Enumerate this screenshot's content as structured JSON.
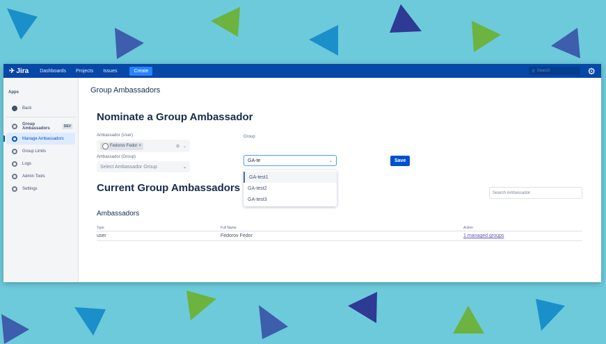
{
  "header": {
    "logo": "Jira",
    "nav": [
      "Dashboards",
      "Projects",
      "Issues"
    ],
    "create": "Create",
    "search_placeholder": "Search"
  },
  "sidebar": {
    "section": "Apps",
    "back": "Back",
    "app": "Group Ambassadors",
    "badge": "DEV",
    "items": [
      "Manage Ambassadors",
      "Group Limits",
      "Logs",
      "Admin Tools",
      "Settings"
    ]
  },
  "main": {
    "page_title": "Group Ambassadors",
    "nominate_title": "Nominate a Group Ambassador",
    "user_label": "Ambassador (User)",
    "user_value": "Fedorov Fedor",
    "group_ambassador_label": "Ambassador (Group)",
    "group_ambassador_placeholder": "Select Ambassador Group",
    "group_label": "Group",
    "group_value": "GA-te",
    "group_options": [
      "GA-test1",
      "GA-test2",
      "GA-test3"
    ],
    "save": "Save",
    "current_title": "Current Group Ambassadors",
    "search_placeholder": "Search Ambassador",
    "table_title": "Ambassadors",
    "columns": [
      "Type",
      "Full Name",
      "Action"
    ],
    "rows": [
      {
        "type": "user",
        "name": "Fedorov Fedor",
        "action": "1 managed groups"
      }
    ]
  }
}
